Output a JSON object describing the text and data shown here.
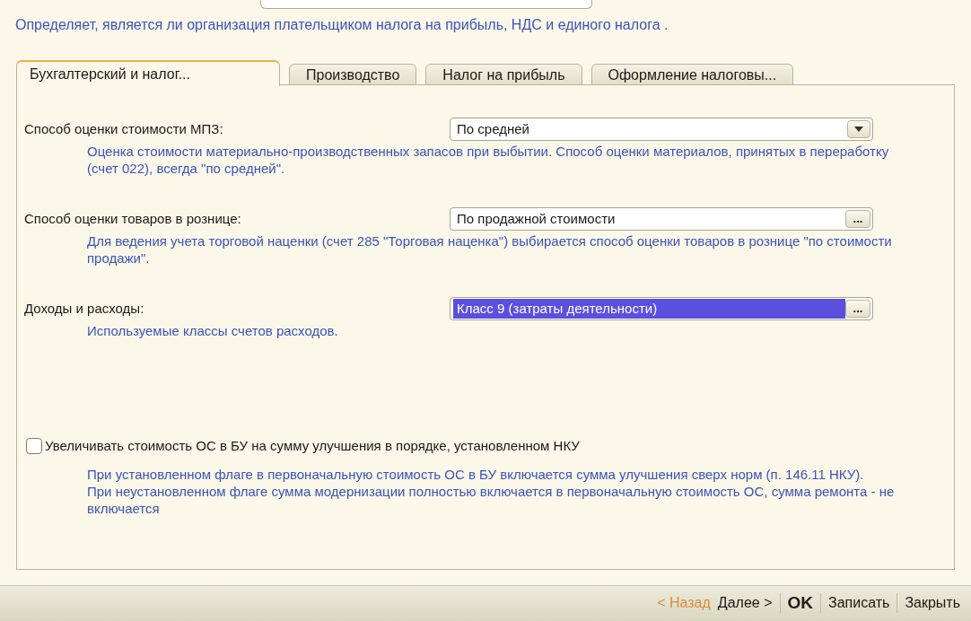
{
  "description": "Определяет, является ли организация плательщиком налога на прибыль, НДС и единого налога .",
  "tabs": [
    {
      "label": "Бухгалтерский  и налог...",
      "selected": true
    },
    {
      "label": "Производство",
      "selected": false
    },
    {
      "label": "Налог на прибыль",
      "selected": false
    },
    {
      "label": "Оформление налоговы...",
      "selected": false
    }
  ],
  "fields": [
    {
      "label": "Способ оценки стоимости МПЗ:",
      "value": "По средней",
      "kind": "dropdown",
      "highlighted": false,
      "hint": "Оценка стоимости материально-производственных запасов при выбытии. Способ оценки материалов, принятых в переработку (счет 022), всегда \"по средней\"."
    },
    {
      "label": "Способ оценки товаров в рознице:",
      "value": "По продажной стоимости",
      "kind": "choice",
      "button": "...",
      "highlighted": false,
      "hint": "Для ведения учета торговой наценки (счет 285 \"Торговая наценка\") выбирается способ оценки товаров в рознице \"по стоимости продажи\"."
    },
    {
      "label": "Доходы и расходы:",
      "value": "Класс 9 (затраты деятельности)",
      "kind": "choice",
      "button": "...",
      "highlighted": true,
      "hint": "Используемые классы счетов расходов."
    }
  ],
  "checkbox": {
    "label": "Увеличивать стоимость ОС в БУ на сумму улучшения в порядке, установленном НКУ",
    "checked": false,
    "hints": [
      "При установленном флаге в первоначальную стоимость ОС в БУ включается сумма улучшения сверх норм (п. 146.11 НКУ).",
      "При неустановленном флаге сумма модернизации полностью включается в первоначальную стоимость ОС, сумма ремонта - не включается"
    ]
  },
  "buttons": [
    {
      "label": "< Назад",
      "disabled": true,
      "bold": false
    },
    {
      "label": "Далее >",
      "disabled": false,
      "bold": false
    },
    {
      "label": "OK",
      "disabled": false,
      "bold": true
    },
    {
      "label": "Записать",
      "disabled": false,
      "bold": false
    },
    {
      "label": "Закрыть",
      "disabled": false,
      "bold": false
    }
  ]
}
